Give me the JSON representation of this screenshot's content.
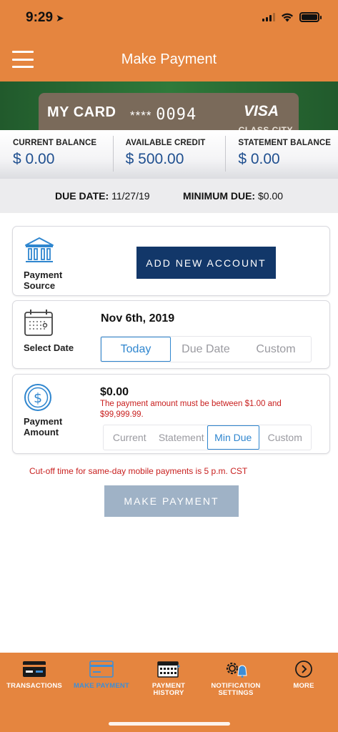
{
  "status_bar": {
    "time": "9:29"
  },
  "nav": {
    "title": "Make Payment"
  },
  "card": {
    "name": "MY CARD",
    "masked": "****",
    "last4": "0094",
    "brand": "VISA",
    "issuer_text": "CLASS CITY"
  },
  "balances": [
    {
      "label": "CURRENT BALANCE",
      "value": "$ 0.00"
    },
    {
      "label": "AVAILABLE CREDIT",
      "value": "$ 500.00"
    },
    {
      "label": "STATEMENT BALANCE",
      "value": "$ 0.00"
    }
  ],
  "due": {
    "date_label": "DUE DATE:",
    "date_value": "11/27/19",
    "min_label": "MINIMUM DUE:",
    "min_value": "$0.00"
  },
  "payment_source": {
    "label_line1": "Payment",
    "label_line2": "Source",
    "button": "ADD NEW ACCOUNT"
  },
  "select_date": {
    "label": "Select Date",
    "date": "Nov 6th, 2019",
    "options": [
      "Today",
      "Due Date",
      "Custom"
    ],
    "selected": "Today"
  },
  "payment_amount": {
    "label_line1": "Payment",
    "label_line2": "Amount",
    "amount": "$0.00",
    "warning": "The payment amount must be between $1.00 and $99,999.99.",
    "options": [
      "Current",
      "Statement",
      "Min Due",
      "Custom"
    ],
    "selected": "Min Due"
  },
  "cutoff_note": "Cut-off time for same-day mobile payments is 5 p.m. CST",
  "make_payment_button": "MAKE PAYMENT",
  "tabs": [
    {
      "line1": "TRANSACTIONS",
      "line2": "",
      "icon": "card-icon"
    },
    {
      "line1": "MAKE PAYMENT",
      "line2": "",
      "icon": "card-outline-icon"
    },
    {
      "line1": "PAYMENT",
      "line2": "HISTORY",
      "icon": "calendar-icon"
    },
    {
      "line1": "NOTIFICATION",
      "line2": "SETTINGS",
      "icon": "gear-bell-icon"
    },
    {
      "line1": "MORE",
      "line2": "",
      "icon": "chevron-circle-icon"
    }
  ],
  "active_tab": "MAKE PAYMENT",
  "colors": {
    "brand_orange": "#e5853f",
    "primary_navy": "#123769",
    "accent_blue": "#2f86cf",
    "error_red": "#c8201f",
    "disabled_button": "#9fb2c6"
  }
}
